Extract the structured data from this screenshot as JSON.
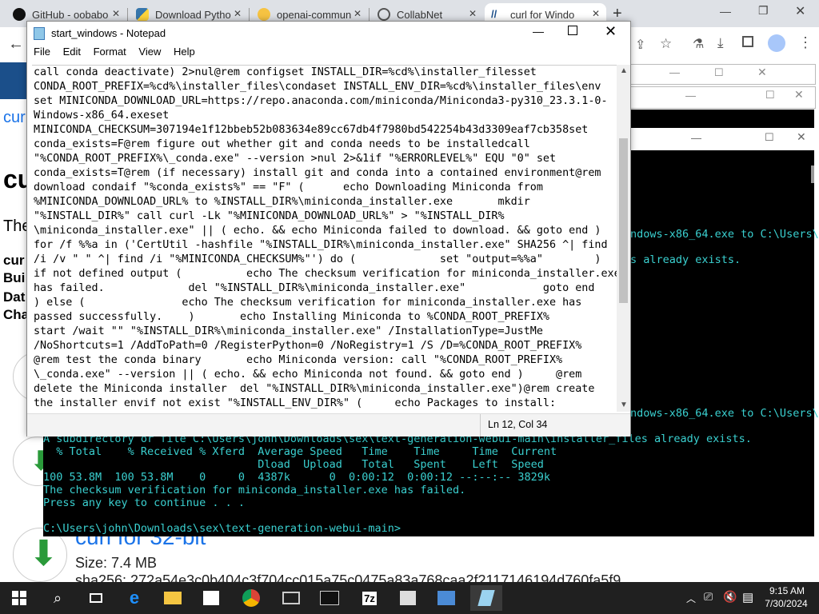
{
  "browser": {
    "tabs": [
      {
        "label": "GitHub - oobabo",
        "icon": "github-icon"
      },
      {
        "label": "Download Pytho",
        "icon": "python-icon"
      },
      {
        "label": "openai-commun",
        "icon": "openai-community-icon"
      },
      {
        "label": "CollabNet",
        "icon": "collabnet-icon"
      },
      {
        "label": "curl for Windo",
        "icon": "curl-icon"
      }
    ],
    "new_tab": "+"
  },
  "page": {
    "left_texts": [
      "cur",
      "cu",
      "The",
      "cur",
      "Bui",
      "Dat",
      "Cha"
    ],
    "download_title": "curl for 32-bit",
    "size": "Size: 7.4 MB",
    "sha": "sha256: 272a54e3c0b404c3f704cc015a75c0475a83a768caa2f2117146194d760fa5f9"
  },
  "console": {
    "right_fragments": [
      "ndows-x86_64.exe to C:\\Users\\j",
      "s already exists.",
      "ndows-x86_64.exe to C:\\Users\\j"
    ],
    "lines": [
      "A subdirectory or file C:\\Users\\john\\Downloads\\sex\\text-generation-webui-main\\installer_files already exists.",
      "  % Total    % Received % Xferd  Average Speed   Time    Time     Time  Current",
      "                                 Dload  Upload   Total   Spent    Left  Speed",
      "100 53.8M  100 53.8M    0     0  4387k      0  0:00:12  0:00:12 --:--:-- 3829k",
      "The checksum verification for miniconda_installer.exe has failed.",
      "Press any key to continue . . .",
      "",
      "C:\\Users\\john\\Downloads\\sex\\text-generation-webui-main>"
    ]
  },
  "notepad": {
    "title": "start_windows - Notepad",
    "menu": [
      "File",
      "Edit",
      "Format",
      "View",
      "Help"
    ],
    "lines": [
      "call conda deactivate) 2>nul@rem configset INSTALL_DIR=%cd%\\installer_filesset",
      "CONDA_ROOT_PREFIX=%cd%\\installer_files\\condaset INSTALL_ENV_DIR=%cd%\\installer_files\\env",
      "set MINICONDA_DOWNLOAD_URL=https://repo.anaconda.com/miniconda/Miniconda3-py310_23.3.1-0-",
      "Windows-x86_64.exeset",
      "MINICONDA_CHECKSUM=307194e1f12bbeb52b083634e89cc67db4f7980bd542254b43d3309eaf7cb358set",
      "conda_exists=F@rem figure out whether git and conda needs to be installedcall",
      "\"%CONDA_ROOT_PREFIX%\\_conda.exe\" --version >nul 2>&1if \"%ERRORLEVEL%\" EQU \"0\" set",
      "conda_exists=T@rem (if necessary) install git and conda into a contained environment@rem",
      "download condaif \"%conda_exists%\" == \"F\" (      echo Downloading Miniconda from",
      "%MINICONDA_DOWNLOAD_URL% to %INSTALL_DIR%\\miniconda_installer.exe       mkdir",
      "\"%INSTALL_DIR%\" call curl -Lk \"%MINICONDA_DOWNLOAD_URL%\" > \"%INSTALL_DIR%",
      "\\miniconda_installer.exe\" || ( echo. && echo Miniconda failed to download. && goto end )",
      "for /f %%a in ('CertUtil -hashfile \"%INSTALL_DIR%\\miniconda_installer.exe\" SHA256 ^| find",
      "/i /v \" \" ^| find /i \"%MINICONDA_CHECKSUM%\"') do (             set \"output=%%a\"        )",
      "if not defined output (          echo The checksum verification for miniconda_installer.exe",
      "has failed.             del \"%INSTALL_DIR%\\miniconda_installer.exe\"            goto end",
      ") else (               echo The checksum verification for miniconda_installer.exe has",
      "passed successfully.    )       echo Installing Miniconda to %CONDA_ROOT_PREFIX%",
      "start /wait \"\" \"%INSTALL_DIR%\\miniconda_installer.exe\" /InstallationType=JustMe",
      "/NoShortcuts=1 /AddToPath=0 /RegisterPython=0 /NoRegistry=1 /S /D=%CONDA_ROOT_PREFIX%",
      "@rem test the conda binary       echo Miniconda version: call \"%CONDA_ROOT_PREFIX%",
      "\\_conda.exe\" --version || ( echo. && echo Miniconda not found. && goto end )     @rem",
      "delete the Miniconda installer  del \"%INSTALL_DIR%\\miniconda_installer.exe\")@rem create",
      "the installer envif not exist \"%INSTALL_ENV_DIR%\" (     echo Packages to install:"
    ],
    "status": "Ln 12, Col 34"
  },
  "taskbar": {
    "time": "9:15 AM",
    "date": "7/30/2024"
  },
  "colors": {
    "console_text": "#3ad0d0",
    "taskbar": "#202020",
    "accent": "#1a73e8"
  }
}
